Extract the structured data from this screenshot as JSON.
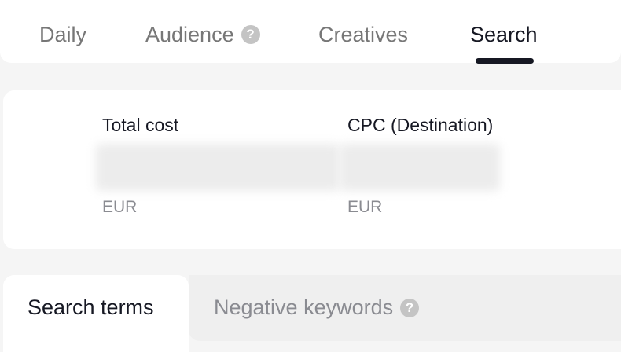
{
  "tabs": [
    {
      "label": "Daily",
      "active": false
    },
    {
      "label": "Audience",
      "active": false,
      "has_help_icon": true
    },
    {
      "label": "Creatives",
      "active": false
    },
    {
      "label": "Search",
      "active": true
    }
  ],
  "help_icon_glyph": "?",
  "metrics": [
    {
      "label": "Total cost",
      "value": "",
      "unit": "EUR"
    },
    {
      "label": "CPC (Destination)",
      "value": "",
      "unit": "EUR"
    }
  ],
  "subtabs": [
    {
      "label": "Search terms",
      "active": true
    },
    {
      "label": "Negative keywords",
      "active": false,
      "has_help_icon": true
    }
  ],
  "colors": {
    "active_text": "#161823",
    "inactive_text": "#777777",
    "muted_text": "#8a8b91",
    "help_icon_bg": "#c4c4c4",
    "background": "#f5f5f5"
  }
}
